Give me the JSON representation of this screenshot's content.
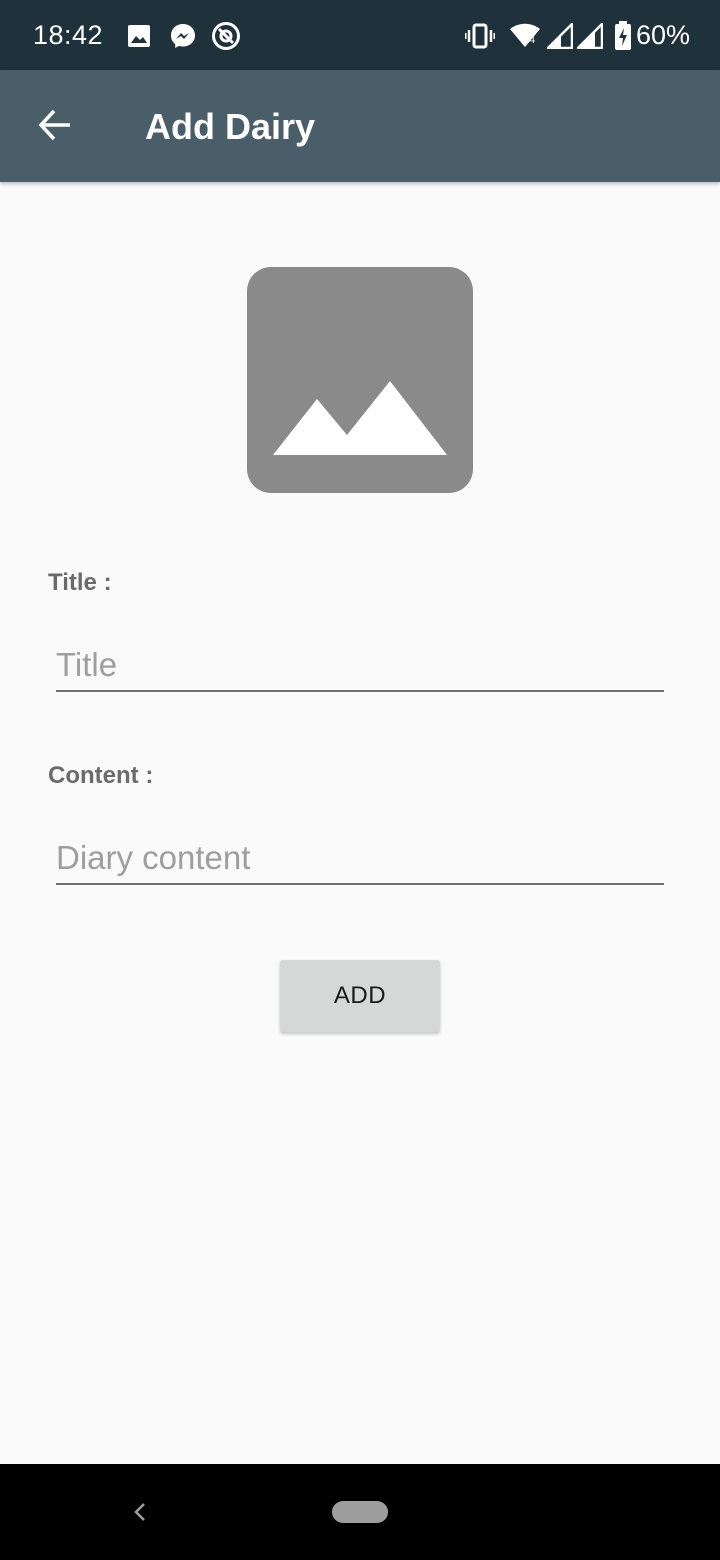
{
  "status_bar": {
    "time": "18:42",
    "battery_percent": "60%",
    "notification_icons": [
      "image-icon",
      "messenger-icon",
      "at-sign-icon"
    ],
    "system_icons": [
      "vibrate-icon",
      "wifi-icon",
      "signal-icon",
      "signal-icon",
      "battery-charging-icon"
    ]
  },
  "app_bar": {
    "title": "Add Dairy",
    "back_icon": "arrow-left-icon"
  },
  "image_picker": {
    "icon": "image-placeholder-icon"
  },
  "form": {
    "title_label": "Title :",
    "title_placeholder": "Title",
    "title_value": "",
    "content_label": "Content :",
    "content_placeholder": "Diary content",
    "content_value": ""
  },
  "add_button": {
    "label": "ADD"
  },
  "nav_bar": {
    "back_icon": "chevron-left-icon",
    "home_icon": "home-pill-icon"
  },
  "colors": {
    "status_bar": "#1f313b",
    "app_bar": "#4a5e6a",
    "background": "#fafafa",
    "placeholder_image": "#8a8a8a",
    "button": "#d6d7d7",
    "label": "#6b6b6b"
  }
}
